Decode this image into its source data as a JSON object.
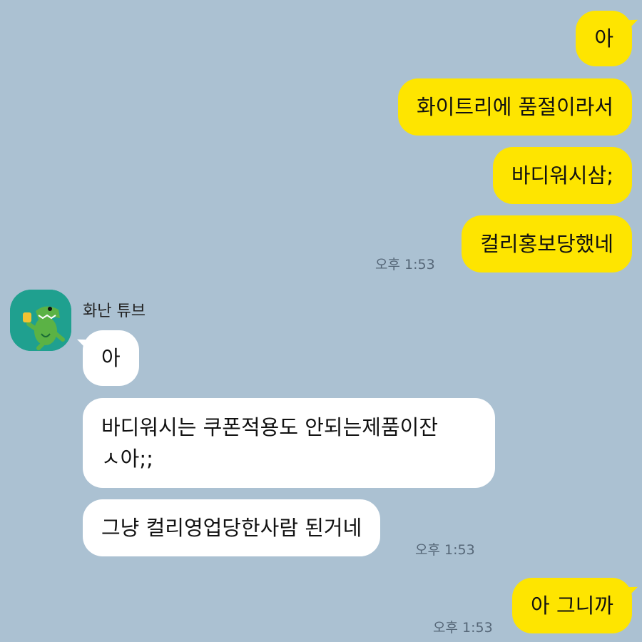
{
  "sent": [
    {
      "text": "아"
    },
    {
      "text": "화이트리에 품절이라서"
    },
    {
      "text": "바디워시삼;"
    },
    {
      "text": "컬리홍보당했네"
    },
    {
      "text": "아 그니까"
    }
  ],
  "received": {
    "sender_name": "화난 튜브",
    "messages": [
      {
        "text": "아"
      },
      {
        "line1": "바디워시는 쿠폰적용도 안되는제품이잔",
        "line2": "ㅅ아;;"
      },
      {
        "text": "그냥 컬리영업당한사람 된거네"
      }
    ]
  },
  "timestamps": {
    "sent_group_1": "오후 1:53",
    "received_group": "오후 1:53",
    "sent_group_2": "오후 1:53"
  },
  "colors": {
    "background": "#abc1d2",
    "sent_bubble": "#fee500",
    "received_bubble": "#ffffff"
  },
  "icons": {
    "avatar": "green-crocodile-character-avatar"
  }
}
